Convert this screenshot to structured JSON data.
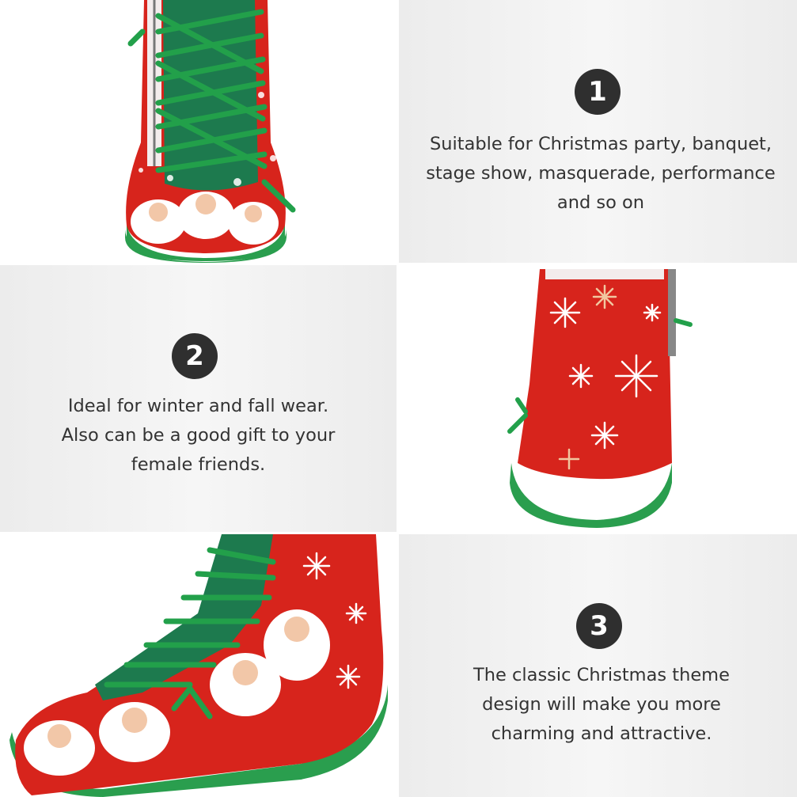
{
  "colors": {
    "boot_red": "#d7241c",
    "boot_green": "#1f8f4a",
    "sole_green": "#2a9e4e",
    "suede_green": "#1d7a4e",
    "badge": "#2f2f2f",
    "text": "#333333"
  },
  "features": [
    {
      "number": "1",
      "text": "Suitable for Christmas party, banquet,\nstage show, masquerade, performance\nand so on"
    },
    {
      "number": "2",
      "text": "Ideal for winter and fall wear.\nAlso can be a good gift to your\nfemale friends."
    },
    {
      "number": "3",
      "text": "The classic Christmas theme\ndesign will make you more\ncharming and attractive."
    }
  ]
}
